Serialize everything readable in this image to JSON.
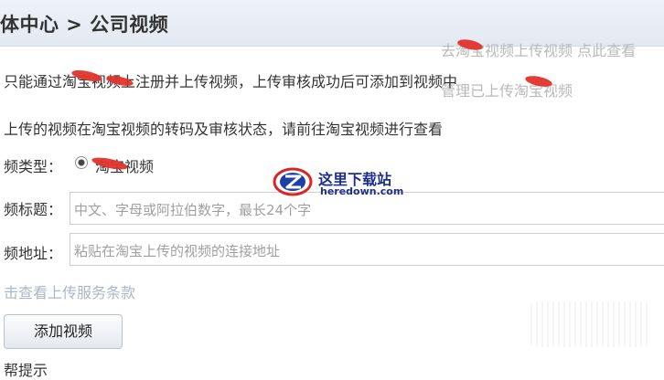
{
  "header": {
    "title": "体中心 > 公司视频"
  },
  "background_hints": {
    "upload_link": "去淘宝视频上传视频 点此查看",
    "manage_link": "管理已上传淘宝视频"
  },
  "notices": {
    "line1": "只能通过淘宝视频上注册并上传视频，上传审核成功后可添加到视频中",
    "line2": "上传的视频在淘宝视频的转码及审核状态，请前往淘宝视频进行查看"
  },
  "form": {
    "type_label": "频类型：",
    "type_option": "淘宝视频",
    "title_label": "频标题：",
    "title_placeholder": "中文、字母或阿拉伯数字，最长24个字",
    "url_label": "频地址：",
    "url_placeholder": "粘贴在淘宝上传的视频的连接地址"
  },
  "terms_link": "击查看上传服务条款",
  "add_button": "添加视频",
  "watermark": {
    "cn": "这里下载站",
    "en": "heredown.com"
  },
  "bottom_partial": "帮提示"
}
